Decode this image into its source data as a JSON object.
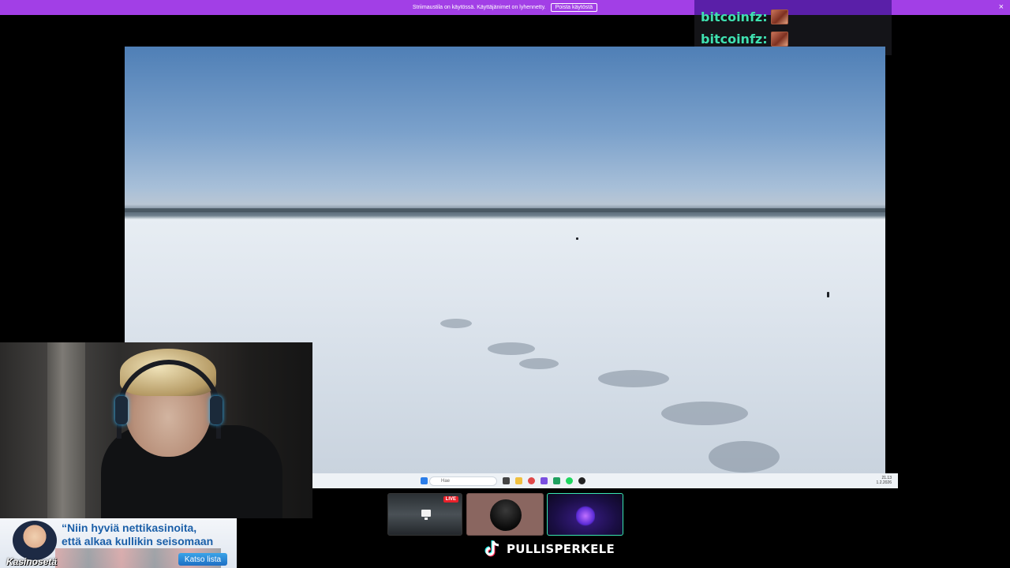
{
  "banner": {
    "text": "Striimaustila on käytössä. Käyttäjänimet on lyhennetty.",
    "button_label": "Poista käytöstä",
    "close_glyph": "×",
    "color": "#a23fe6"
  },
  "chat": {
    "messages": [
      {
        "user": "bitcoinfz:",
        "emote": "emote-image"
      },
      {
        "user": "bitcoinfz:",
        "emote": "emote-image"
      }
    ],
    "username_color": "#3fe0b0"
  },
  "taskbar": {
    "search_placeholder": "Hae",
    "time": "21.13",
    "date": "1.2.2026",
    "icons": [
      "start-icon",
      "search-icon",
      "taskview-icon",
      "explorer-icon",
      "browser-icon",
      "chrome-icon",
      "store-icon",
      "spotify-icon",
      "media-icon"
    ]
  },
  "ad": {
    "quote_line1": "“Niin hyviä nettikasinoita,",
    "quote_line2": "että alkaa kullikin seisomaan",
    "brand": "Kasinosetä",
    "cta": "Katso lista"
  },
  "thumbnails": {
    "live_label": "LIVE"
  },
  "tiktok": {
    "username": "PULLISPERKELE"
  }
}
